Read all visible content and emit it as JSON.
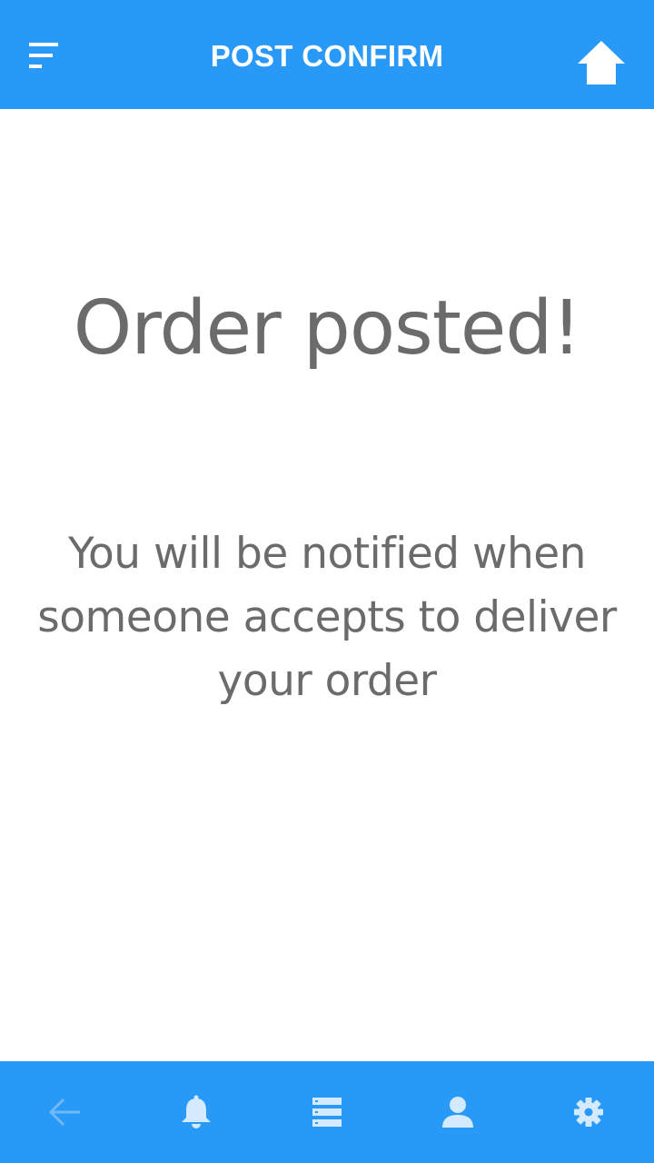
{
  "header": {
    "title": "POST CONFIRM",
    "menu_icon": "menu-icon",
    "home_icon": "home-icon"
  },
  "main": {
    "headline": "Order posted!",
    "message": "You will be notified when someone accepts to deliver your order"
  },
  "bottom_nav": {
    "items": [
      {
        "icon": "back-arrow-icon",
        "state": "disabled"
      },
      {
        "icon": "bell-icon",
        "state": "active"
      },
      {
        "icon": "list-icon",
        "state": "active"
      },
      {
        "icon": "user-icon",
        "state": "active"
      },
      {
        "icon": "gear-icon",
        "state": "active"
      }
    ]
  },
  "colors": {
    "bar_background": "#2999f7",
    "header_text": "#ffffff",
    "body_text": "#6b6b6b",
    "nav_icon": "#d4ebff",
    "nav_icon_disabled": "#6fb9f9"
  }
}
